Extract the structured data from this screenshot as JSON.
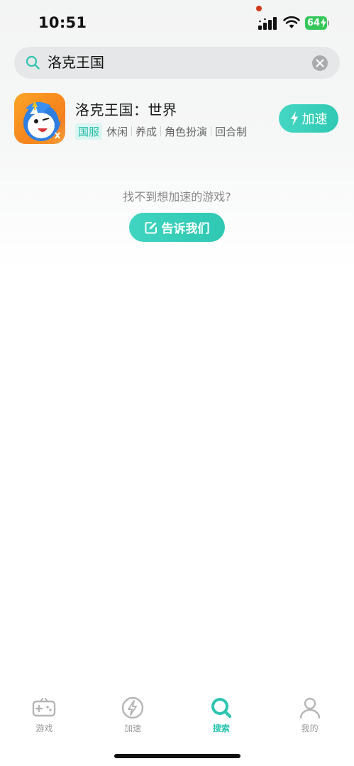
{
  "status_bar": {
    "time": "10:51",
    "battery_level": "64",
    "battery_color": "#35c759"
  },
  "search": {
    "query": "洛克王国",
    "search_icon": "search-icon",
    "clear_icon": "clear-icon"
  },
  "result": {
    "title": "洛克王国：世界",
    "region_tag": "国服",
    "tags": [
      "休闲",
      "养成",
      "角色扮演",
      "回合制"
    ],
    "action_label": "加速",
    "action_icon": "lightning-icon",
    "accent_color": "#33cab4"
  },
  "feedback": {
    "prompt": "找不到想加速的游戏?",
    "button_label": "告诉我们",
    "button_icon": "edit-icon"
  },
  "tabbar": {
    "tabs": [
      {
        "label": "游戏",
        "icon": "gamepad-icon",
        "active": false
      },
      {
        "label": "加速",
        "icon": "lightning-circle-icon",
        "active": false
      },
      {
        "label": "搜索",
        "icon": "search-icon",
        "active": true
      },
      {
        "label": "我的",
        "icon": "person-icon",
        "active": false
      }
    ]
  }
}
